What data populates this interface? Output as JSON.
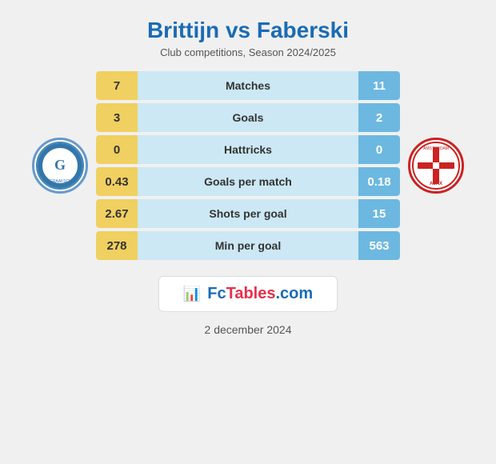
{
  "header": {
    "title": "Brittijn vs Faberski",
    "subtitle": "Club competitions, Season 2024/2025"
  },
  "stats": [
    {
      "label": "Matches",
      "left": "7",
      "right": "11"
    },
    {
      "label": "Goals",
      "left": "3",
      "right": "2"
    },
    {
      "label": "Hattricks",
      "left": "0",
      "right": "0"
    },
    {
      "label": "Goals per match",
      "left": "0.43",
      "right": "0.18"
    },
    {
      "label": "Shots per goal",
      "left": "2.67",
      "right": "15"
    },
    {
      "label": "Min per goal",
      "left": "278",
      "right": "563"
    }
  ],
  "watermark": {
    "text_plain": "FcTables.com"
  },
  "footer": {
    "date": "2 december 2024"
  }
}
